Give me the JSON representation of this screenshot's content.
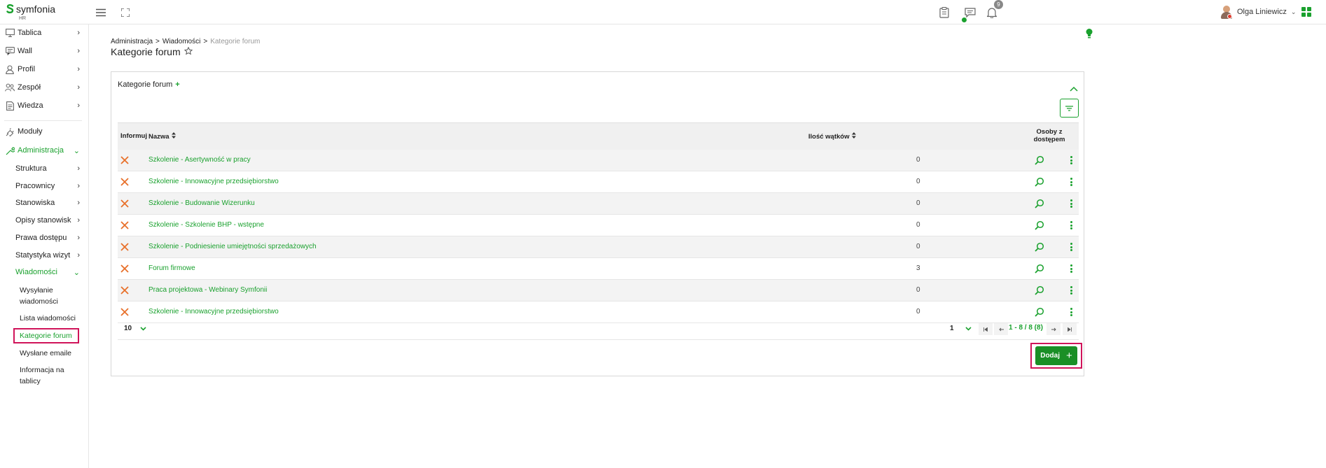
{
  "brand": {
    "name": "symfonia",
    "product": "HR"
  },
  "header": {
    "user_name": "Olga Liniewicz",
    "notifications_count": "9"
  },
  "sidebar": {
    "items": [
      {
        "label": "Tablica"
      },
      {
        "label": "Wall"
      },
      {
        "label": "Profil"
      },
      {
        "label": "Zespół"
      },
      {
        "label": "Wiedza"
      },
      {
        "label": "Moduły"
      },
      {
        "label": "Administracja"
      }
    ],
    "admin_sub": [
      {
        "label": "Struktura"
      },
      {
        "label": "Pracownicy"
      },
      {
        "label": "Stanowiska"
      },
      {
        "label": "Opisy stanowisk"
      },
      {
        "label": "Prawa dostępu"
      },
      {
        "label": "Statystyka wizyt"
      },
      {
        "label": "Wiadomości"
      }
    ],
    "messages_sub": [
      {
        "label": "Wysyłanie wiadomości"
      },
      {
        "label": "Lista wiadomości"
      },
      {
        "label": "Kategorie forum"
      },
      {
        "label": "Wysłane emaile"
      },
      {
        "label": "Informacja na tablicy"
      }
    ]
  },
  "breadcrumb": {
    "items": [
      "Administracja",
      ">",
      "Wiadomości",
      ">",
      "Kategorie forum"
    ]
  },
  "page_title": "Kategorie forum",
  "panel": {
    "title": "Kategorie forum",
    "title_plus": "+",
    "columns": {
      "informuj": "Informuj",
      "nazwa": "Nazwa",
      "ilosc": "Ilość wątków",
      "osoby_line1": "Osoby z",
      "osoby_line2": "dostępem"
    },
    "rows": [
      {
        "name": "Szkolenie - Asertywność w pracy",
        "count": "0"
      },
      {
        "name": "Szkolenie - Innowacyjne przedsiębiorstwo",
        "count": "0"
      },
      {
        "name": "Szkolenie - Budowanie Wizerunku",
        "count": "0"
      },
      {
        "name": "Szkolenie - Szkolenie BHP - wstępne",
        "count": "0"
      },
      {
        "name": "Szkolenie - Podniesienie umiejętności sprzedażowych",
        "count": "0"
      },
      {
        "name": "Forum firmowe",
        "count": "3"
      },
      {
        "name": "Praca projektowa - Webinary Symfonii",
        "count": "0"
      },
      {
        "name": "Szkolenie - Innowacyjne przedsiębiorstwo",
        "count": "0"
      }
    ],
    "pagination": {
      "per_page": "10",
      "page": "1",
      "info": "1 - 8 / 8 (8)"
    },
    "add_button": "Dodaj",
    "add_plus": "+"
  },
  "colors": {
    "accent": "#1aa12e",
    "highlight": "#d0145a",
    "delete": "#e8702a"
  }
}
